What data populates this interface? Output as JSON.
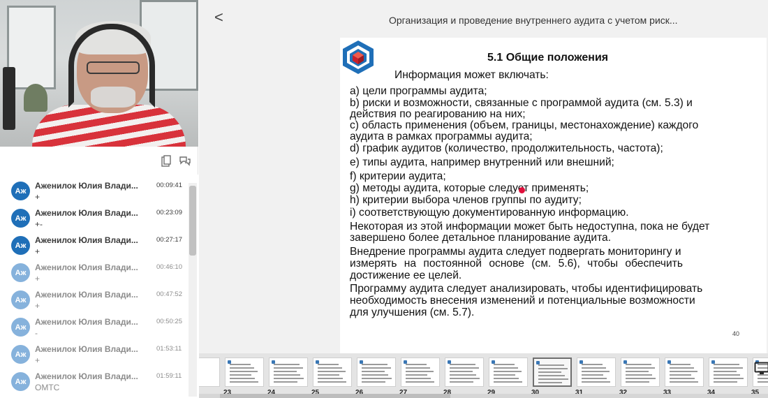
{
  "video": {
    "participant": "speaker-video"
  },
  "toolbar": {
    "icons": [
      "clipboard-icon",
      "chat-bubbles-icon"
    ]
  },
  "chat": {
    "messages": [
      {
        "initials": "Аж",
        "name": "Аженилок Юлия Влади...",
        "time": "00:09:41",
        "text": "+",
        "faded": false
      },
      {
        "initials": "Аж",
        "name": "Аженилок Юлия Влади...",
        "time": "00:23:09",
        "text": "+-",
        "faded": false
      },
      {
        "initials": "Аж",
        "name": "Аженилок Юлия Влади...",
        "time": "00:27:17",
        "text": "+",
        "faded": false
      },
      {
        "initials": "Аж",
        "name": "Аженилок Юлия Влади...",
        "time": "00:46:10",
        "text": "+",
        "faded": true
      },
      {
        "initials": "Аж",
        "name": "Аженилок Юлия Влади...",
        "time": "00:47:52",
        "text": "+",
        "faded": true
      },
      {
        "initials": "Аж",
        "name": "Аженилок Юлия Влади...",
        "time": "00:50:25",
        "text": "-",
        "faded": true
      },
      {
        "initials": "Аж",
        "name": "Аженилок Юлия Влади...",
        "time": "01:53:11",
        "text": "+",
        "faded": true
      },
      {
        "initials": "Аж",
        "name": "Аженилок Юлия Влади...",
        "time": "01:59:11",
        "text": "ОМТС",
        "faded": true
      }
    ]
  },
  "header": {
    "back_label": "<",
    "title": "Организация и проведение внутреннего аудита с учетом риск..."
  },
  "slide": {
    "title": "5.1 Общие положения",
    "lines": [
      "Информация может включать:",
      "a)  цели программы аудита;",
      "b)  риски и возможности, связанные с программой аудита (см. 5.3) и",
      "      действия по реагированию на них;",
      "c)  область применения (объем, границы, местонахождение) каждого",
      "      аудита в рамках программы аудита;",
      "d)  график аудитов (количество, продолжительность, частота);",
      "e)  типы аудита, например внутренний или внешний;",
      "f)   критерии аудита;",
      "g) методы аудита, которые следует применять;",
      "h) критерии выбора членов группы по аудиту;",
      "i) соответствующую документированную информацию.",
      "Некоторая из этой информации может быть недоступна, пока не будет",
      "завершено более детальное планирование аудита.",
      "    Внедрение программы аудита следует подвергать мониторингу и",
      "измерять на постоянной основе (см. 5.6), чтобы   обеспечить",
      "достижение ее целей.",
      "Программу аудита следует  анализировать, чтобы идентифицировать",
      "необходимость  внесения изменений и потенциальные возможности",
      "для улучшения (см. 5.7)."
    ],
    "page_number": "40"
  },
  "thumbnails": {
    "numbers": [
      "23",
      "24",
      "25",
      "26",
      "27",
      "28",
      "29",
      "30",
      "31",
      "32",
      "33",
      "34",
      "35"
    ],
    "active": "30"
  },
  "colors": {
    "avatar_active": "#1f6fb8",
    "avatar_faded": "#86b2dc",
    "name_active": "#3a3a3a",
    "name_faded": "#8c8c8c",
    "pointer": "#e0103c"
  }
}
